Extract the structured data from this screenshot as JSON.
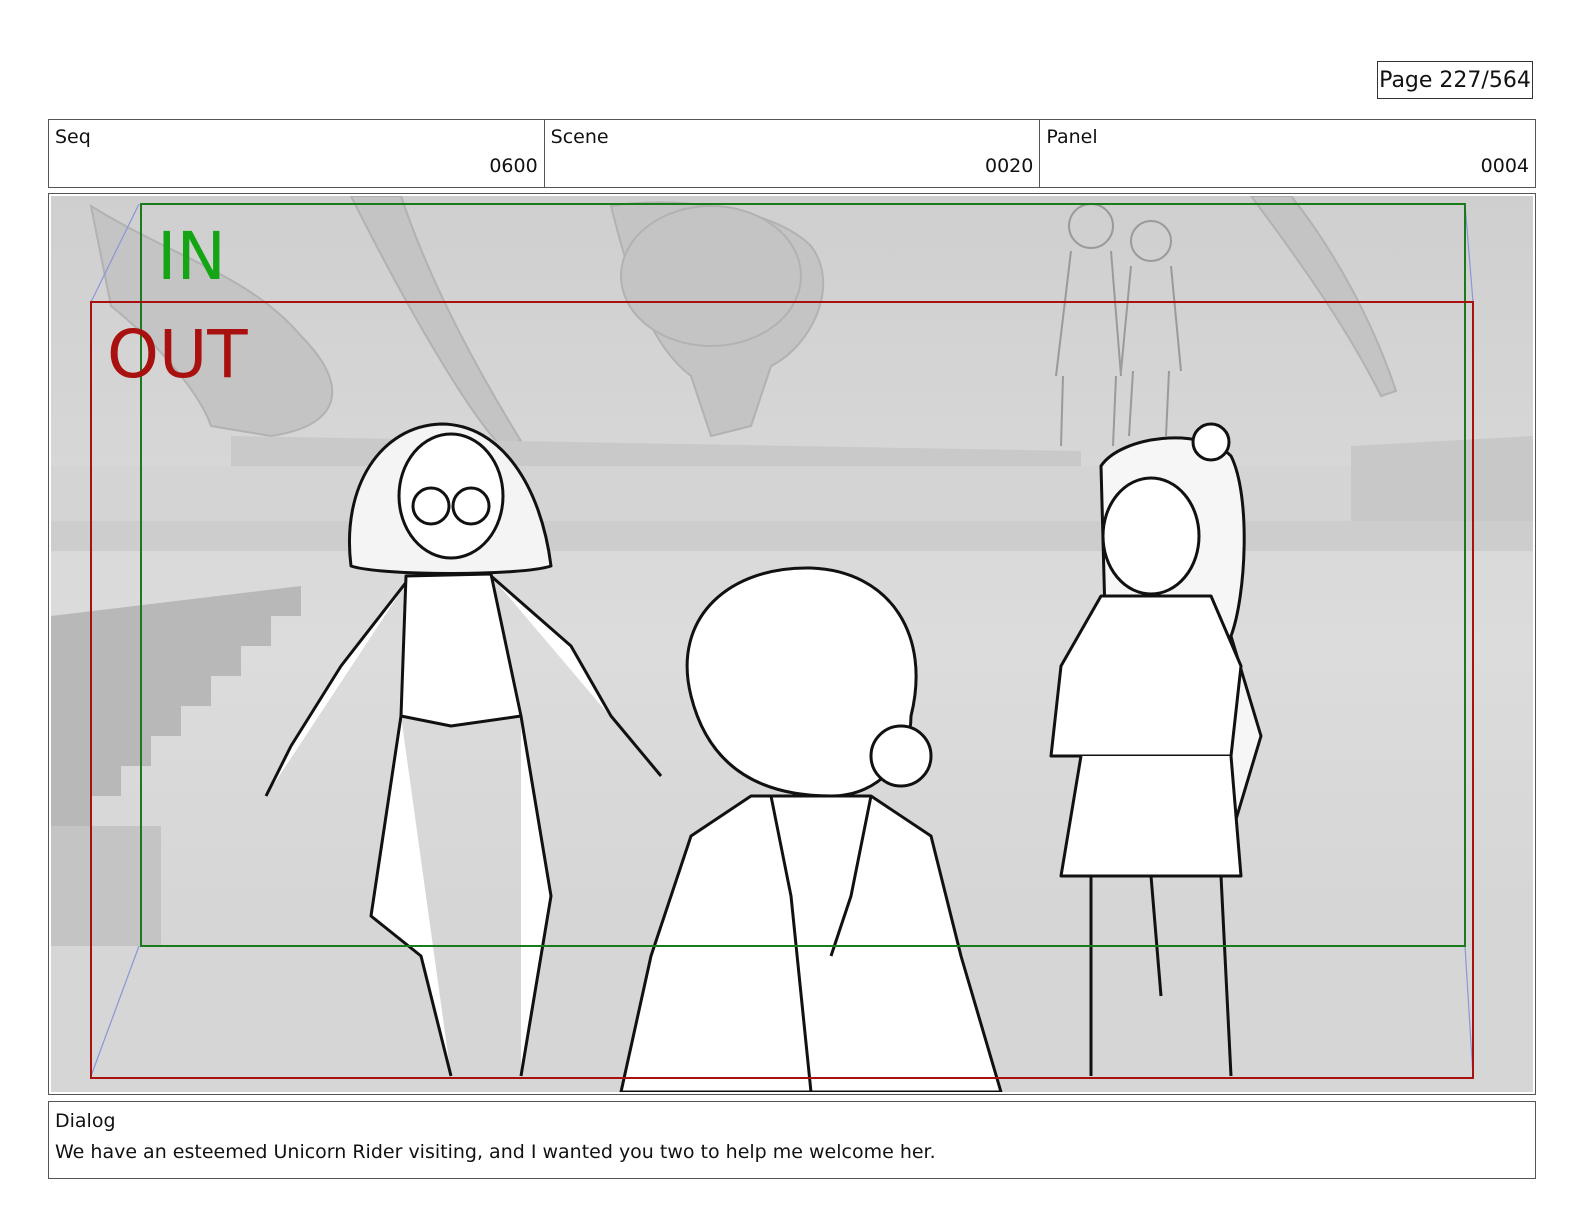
{
  "page": {
    "label": "Page 227/564"
  },
  "header": {
    "seq": {
      "label": "Seq",
      "value": "0600"
    },
    "scene": {
      "label": "Scene",
      "value": "0020"
    },
    "panel": {
      "label": "Panel",
      "value": "0004"
    }
  },
  "frame": {
    "in_label": "IN",
    "out_label": "OUT",
    "colors": {
      "in": "#14a514",
      "out": "#a8110f",
      "guide": "#8c95d8",
      "background": "#d9d9d9"
    }
  },
  "dialog": {
    "label": "Dialog",
    "text": "We have an esteemed Unicorn Rider visiting, and I wanted you two to help me welcome her."
  }
}
